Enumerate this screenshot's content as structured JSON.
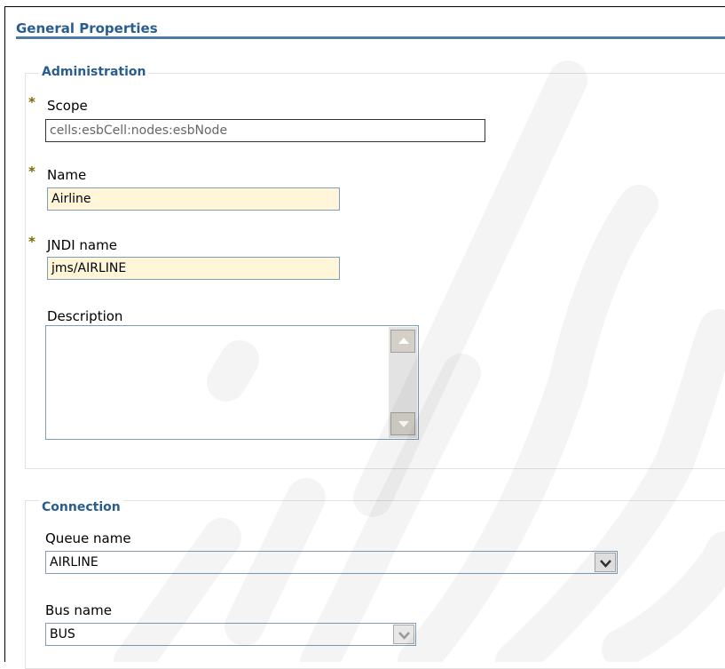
{
  "general": {
    "title": "General Properties"
  },
  "administration": {
    "legend": "Administration",
    "required_marker": "*",
    "scope": {
      "label": "Scope",
      "value": "cells:esbCell:nodes:esbNode"
    },
    "name": {
      "label": "Name",
      "value": "Airline"
    },
    "jndi": {
      "label": "JNDI name",
      "value": "jms/AIRLINE"
    },
    "description": {
      "label": "Description",
      "value": ""
    }
  },
  "connection": {
    "legend": "Connection",
    "queue": {
      "label": "Queue name",
      "selected": "AIRLINE"
    },
    "bus": {
      "label": "Bus name",
      "selected": "BUS"
    }
  },
  "colors": {
    "heading": "#2a5d8f",
    "required_field_bg": "#fff5d9",
    "required_marker": "#7a6a00"
  }
}
